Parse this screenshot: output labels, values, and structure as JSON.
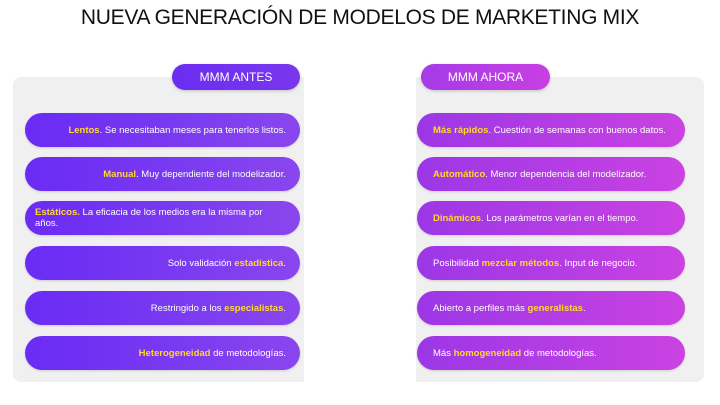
{
  "title": "NUEVA GENERACIÓN DE MODELOS DE MARKETING MIX",
  "headers": {
    "left": "MMM ANTES",
    "right": "MMM AHORA"
  },
  "colors": {
    "highlight": "#ffd92e",
    "left_purple": "#6a2bf5",
    "right_magenta": "#cb42e2",
    "panel": "#f0f0f1"
  },
  "left_rows": [
    {
      "pre": "",
      "hl": "Lentos",
      "post": ". Se necesitaban meses para tenerlos listos."
    },
    {
      "pre": "",
      "hl": "Manual",
      "post": ". Muy dependiente del modelizador."
    },
    {
      "pre": "",
      "hl": "Estáticos.",
      "post": " La eficacia de los medios era la misma por años."
    },
    {
      "pre": "Solo validación ",
      "hl": "estadística",
      "post": "."
    },
    {
      "pre": "Restringido a los ",
      "hl": "especialistas",
      "post": "."
    },
    {
      "pre": "",
      "hl": "Heterogeneidad",
      "post": " de metodologías."
    }
  ],
  "right_rows": [
    {
      "pre": "",
      "hl": "Más rápidos",
      "post": ". Cuestión de semanas con buenos datos."
    },
    {
      "pre": "",
      "hl": "Automático",
      "post": ". Menor dependencia del modelizador."
    },
    {
      "pre": "",
      "hl": "Dinámicos",
      "post": ". Los parámetros varían en el tiempo."
    },
    {
      "pre": "Posibilidad ",
      "hl": "mezclar métodos",
      "post": ". Input de negocio."
    },
    {
      "pre": "Abierto a perfiles más ",
      "hl": "generalistas",
      "post": "."
    },
    {
      "pre": "Más ",
      "hl": "homogeneidad",
      "post": " de metodologías."
    }
  ]
}
